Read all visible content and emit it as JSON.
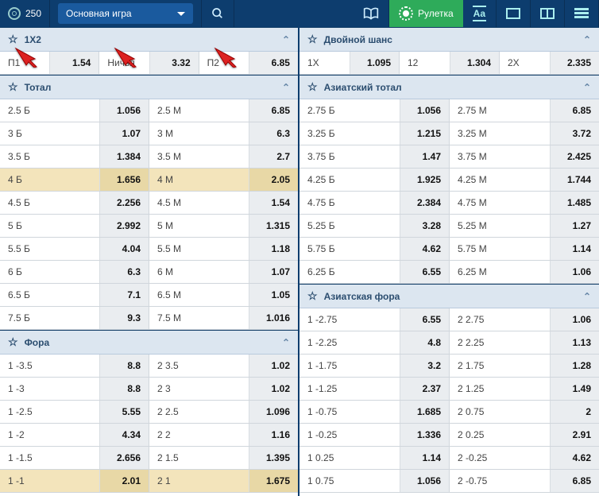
{
  "topbar": {
    "balance": "250",
    "game_label": "Основная игра",
    "roulette_label": "Рулетка"
  },
  "col_left": [
    {
      "title": "1X2",
      "star": true,
      "arrows": true,
      "rows": [
        [
          {
            "label": "П1",
            "odds": "1.54"
          },
          {
            "label": "Ничья",
            "odds": "3.32"
          },
          {
            "label": "П2",
            "odds": "6.85"
          }
        ]
      ]
    },
    {
      "title": "Тотал",
      "star": true,
      "rows": [
        [
          {
            "label": "2.5 Б",
            "odds": "1.056"
          },
          {
            "label": "2.5 М",
            "odds": "6.85"
          }
        ],
        [
          {
            "label": "3 Б",
            "odds": "1.07"
          },
          {
            "label": "3 М",
            "odds": "6.3"
          }
        ],
        [
          {
            "label": "3.5 Б",
            "odds": "1.384"
          },
          {
            "label": "3.5 М",
            "odds": "2.7"
          }
        ],
        [
          {
            "label": "4 Б",
            "odds": "1.656",
            "hl": true
          },
          {
            "label": "4 М",
            "odds": "2.05",
            "hl": true
          }
        ],
        [
          {
            "label": "4.5 Б",
            "odds": "2.256"
          },
          {
            "label": "4.5 М",
            "odds": "1.54"
          }
        ],
        [
          {
            "label": "5 Б",
            "odds": "2.992"
          },
          {
            "label": "5 М",
            "odds": "1.315"
          }
        ],
        [
          {
            "label": "5.5 Б",
            "odds": "4.04"
          },
          {
            "label": "5.5 М",
            "odds": "1.18"
          }
        ],
        [
          {
            "label": "6 Б",
            "odds": "6.3"
          },
          {
            "label": "6 М",
            "odds": "1.07"
          }
        ],
        [
          {
            "label": "6.5 Б",
            "odds": "7.1"
          },
          {
            "label": "6.5 М",
            "odds": "1.05"
          }
        ],
        [
          {
            "label": "7.5 Б",
            "odds": "9.3"
          },
          {
            "label": "7.5 М",
            "odds": "1.016"
          }
        ]
      ]
    },
    {
      "title": "Фора",
      "star": true,
      "rows": [
        [
          {
            "label": "1 -3.5",
            "odds": "8.8"
          },
          {
            "label": "2 3.5",
            "odds": "1.02"
          }
        ],
        [
          {
            "label": "1 -3",
            "odds": "8.8"
          },
          {
            "label": "2 3",
            "odds": "1.02"
          }
        ],
        [
          {
            "label": "1 -2.5",
            "odds": "5.55"
          },
          {
            "label": "2 2.5",
            "odds": "1.096"
          }
        ],
        [
          {
            "label": "1 -2",
            "odds": "4.34"
          },
          {
            "label": "2 2",
            "odds": "1.16"
          }
        ],
        [
          {
            "label": "1 -1.5",
            "odds": "2.656"
          },
          {
            "label": "2 1.5",
            "odds": "1.395"
          }
        ],
        [
          {
            "label": "1 -1",
            "odds": "2.01",
            "hl": true
          },
          {
            "label": "2 1",
            "odds": "1.675",
            "hl": true
          }
        ]
      ]
    }
  ],
  "col_right": [
    {
      "title": "Двойной шанс",
      "star": true,
      "rows": [
        [
          {
            "label": "1X",
            "odds": "1.095"
          },
          {
            "label": "12",
            "odds": "1.304"
          },
          {
            "label": "2X",
            "odds": "2.335"
          }
        ]
      ]
    },
    {
      "title": "Азиатский тотал",
      "star": true,
      "rows": [
        [
          {
            "label": "2.75 Б",
            "odds": "1.056"
          },
          {
            "label": "2.75 М",
            "odds": "6.85"
          }
        ],
        [
          {
            "label": "3.25 Б",
            "odds": "1.215"
          },
          {
            "label": "3.25 М",
            "odds": "3.72"
          }
        ],
        [
          {
            "label": "3.75 Б",
            "odds": "1.47"
          },
          {
            "label": "3.75 М",
            "odds": "2.425"
          }
        ],
        [
          {
            "label": "4.25 Б",
            "odds": "1.925"
          },
          {
            "label": "4.25 М",
            "odds": "1.744"
          }
        ],
        [
          {
            "label": "4.75 Б",
            "odds": "2.384"
          },
          {
            "label": "4.75 М",
            "odds": "1.485"
          }
        ],
        [
          {
            "label": "5.25 Б",
            "odds": "3.28"
          },
          {
            "label": "5.25 М",
            "odds": "1.27"
          }
        ],
        [
          {
            "label": "5.75 Б",
            "odds": "4.62"
          },
          {
            "label": "5.75 М",
            "odds": "1.14"
          }
        ],
        [
          {
            "label": "6.25 Б",
            "odds": "6.55"
          },
          {
            "label": "6.25 М",
            "odds": "1.06"
          }
        ]
      ]
    },
    {
      "title": "Азиатская фора",
      "star": true,
      "rows": [
        [
          {
            "label": "1 -2.75",
            "odds": "6.55"
          },
          {
            "label": "2 2.75",
            "odds": "1.06"
          }
        ],
        [
          {
            "label": "1 -2.25",
            "odds": "4.8"
          },
          {
            "label": "2 2.25",
            "odds": "1.13"
          }
        ],
        [
          {
            "label": "1 -1.75",
            "odds": "3.2"
          },
          {
            "label": "2 1.75",
            "odds": "1.28"
          }
        ],
        [
          {
            "label": "1 -1.25",
            "odds": "2.37"
          },
          {
            "label": "2 1.25",
            "odds": "1.49"
          }
        ],
        [
          {
            "label": "1 -0.75",
            "odds": "1.685"
          },
          {
            "label": "2 0.75",
            "odds": "2"
          }
        ],
        [
          {
            "label": "1 -0.25",
            "odds": "1.336"
          },
          {
            "label": "2 0.25",
            "odds": "2.91"
          }
        ],
        [
          {
            "label": "1 0.25",
            "odds": "1.14"
          },
          {
            "label": "2 -0.25",
            "odds": "4.62"
          }
        ],
        [
          {
            "label": "1 0.75",
            "odds": "1.056"
          },
          {
            "label": "2 -0.75",
            "odds": "6.85"
          }
        ]
      ]
    }
  ]
}
